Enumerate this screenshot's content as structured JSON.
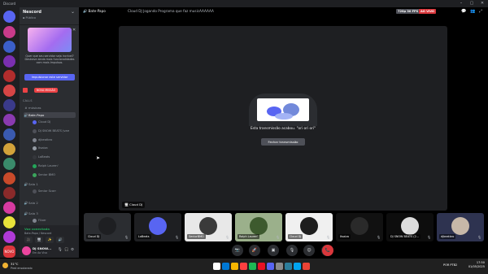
{
  "window": {
    "app_name": "Discord",
    "controls": {
      "minimize": "–",
      "maximize": "▢",
      "close": "✕"
    }
  },
  "server": {
    "name": "Nescord",
    "subtitle": "▪ Público",
    "promo_text": "Quer que seu servidor seja incrível? Destrave ainda mais funcionalidades com mais Impulsos.",
    "promo_button": "Impulsionar este servidor",
    "event_badge": "NOVA MISSÃO",
    "category": "CALLS",
    "channels": [
      {
        "icon": "#",
        "label": "músicas",
        "active": false
      },
      {
        "icon": "🔊",
        "label": "Bate-Papo",
        "active": true
      }
    ],
    "voice_users": [
      {
        "name": "Cloud DJ",
        "avatar_color": "#5865f2"
      },
      {
        "name": "DJ SNOW BEATS (vamos...",
        "avatar_color": "#4e5058"
      },
      {
        "name": "djbeatbro",
        "avatar_color": "#80848e"
      },
      {
        "name": "Itsaiza",
        "avatar_color": "#949ba4"
      },
      {
        "name": "LoBeats",
        "avatar_color": "#35373c"
      },
      {
        "name": "Ralph Lauren'",
        "avatar_color": "#23a559"
      },
      {
        "name": "Senior BMO",
        "avatar_color": "#3ba55c"
      }
    ],
    "more_channels": [
      {
        "label": "Sala 1",
        "sub": "Senior Scarr"
      },
      {
        "label": "Sala 2",
        "sub": ""
      },
      {
        "label": "Sala 3",
        "sub": "Flixer"
      }
    ]
  },
  "voice_connection": {
    "status": "Voz conectada",
    "location": "Bate-Papo / Nescord",
    "buttons": [
      "🎥",
      "🖥",
      "✨",
      "🔊"
    ]
  },
  "user": {
    "name": "DJ SNOW...",
    "status": "Em Ao Vivo",
    "icons": [
      "🎙",
      "🎧",
      "⚙"
    ]
  },
  "top_bar": {
    "channel": "🔊 Bate-Papo",
    "stream_status": "Cloud DJ Jogando Programa que faz musicAAAAAA",
    "badge_quality": "720p 30 FPS",
    "badge_live": "AO VIVO",
    "icons": [
      "💬",
      "👥",
      "⤢"
    ]
  },
  "stage": {
    "message": "Esta transmissão acabou. \"ori ori ori\"",
    "close_button": "Fechar transmissão",
    "stream_owner": "🖥 Cloud DJ"
  },
  "strip": {
    "left_note": "Esta transmissão acabou.",
    "tiles": [
      {
        "name": "Cloud DJ",
        "bg": "#2b2d31",
        "face": "#1e1f22"
      },
      {
        "name": "LoBeats",
        "bg": "#1e1f22",
        "face": "#5865f2"
      },
      {
        "name": "SeniorBMO",
        "bg": "#e8e8e8",
        "face": "#3a3a3a"
      },
      {
        "name": "Ralph Lauren'",
        "bg": "#9bb08b",
        "face": "#3d5a2e"
      },
      {
        "name": "Cloud DJ",
        "bg": "#f0f0f0",
        "face": "#1e1e1e"
      },
      {
        "name": "Itsaiza",
        "bg": "#111111",
        "face": "#2a2a2a"
      },
      {
        "name": "DJ SNOW BEATS (2...",
        "bg": "#0d0d0d",
        "face": "#dcdcdc"
      },
      {
        "name": "djbeatbro",
        "bg": "#2e3350",
        "face": "#c7b8a8"
      }
    ]
  },
  "controls": [
    "📷",
    "🚀",
    "▣",
    "🎙",
    "😊",
    "🖥",
    "📞"
  ],
  "taskbar": {
    "weather_temp": "31°C",
    "weather_desc": "Pred ensolarado",
    "clock_time": "17:50",
    "clock_date": "01/05/2025",
    "lang": "POR PTB2",
    "apps_colors": [
      "#ffffff",
      "#0078d4",
      "#f7b500",
      "#ff4040",
      "#1db954",
      "#e81123",
      "#5865f2",
      "#8a8a8a",
      "#2d7d9a",
      "#00a4ef",
      "#ea4335"
    ]
  },
  "colors": {
    "accent": "#5865f2",
    "danger": "#da373c",
    "online": "#23a559"
  }
}
